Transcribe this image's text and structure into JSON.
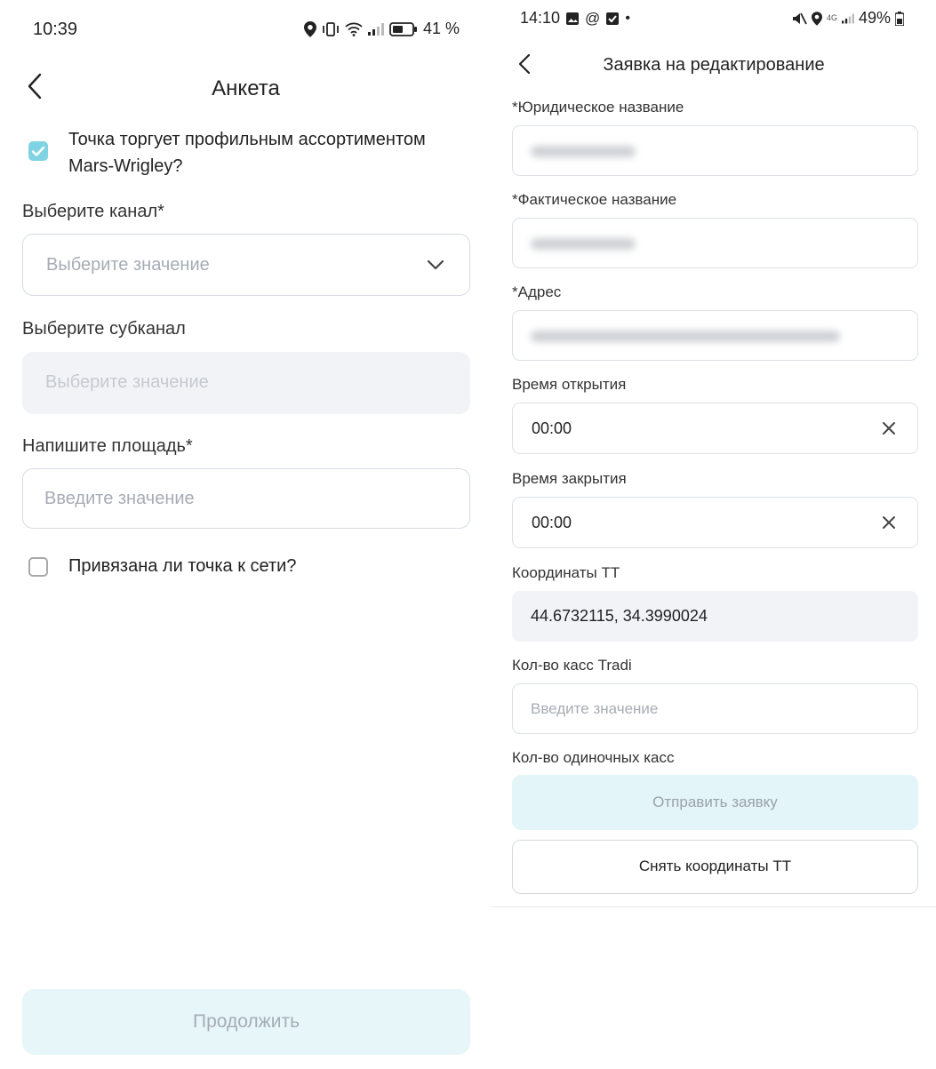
{
  "left": {
    "status": {
      "time": "10:39",
      "battery": "41 %"
    },
    "title": "Анкета",
    "question_mars": "Точка торгует профильным ассортиментом Mars-Wrigley?",
    "channel": {
      "label": "Выберите канал*",
      "placeholder": "Выберите значение"
    },
    "subchannel": {
      "label": "Выберите субканал",
      "placeholder": "Выберите значение"
    },
    "area": {
      "label": "Напишите площадь*",
      "placeholder": "Введите значение"
    },
    "question_network": "Привязана ли точка к сети?",
    "continue_label": "Продолжить"
  },
  "right": {
    "status": {
      "time": "14:10",
      "battery": "49%"
    },
    "title": "Заявка на редактирование",
    "legal_name": {
      "label": "*Юридическое название"
    },
    "actual_name": {
      "label": "*Фактическое название"
    },
    "address": {
      "label": "*Адрес"
    },
    "open_time": {
      "label": "Время открытия",
      "value": "00:00"
    },
    "close_time": {
      "label": "Время закрытия",
      "value": "00:00"
    },
    "coords": {
      "label": "Координаты ТТ",
      "value": "44.6732115, 34.3990024"
    },
    "registers_tradi": {
      "label": "Кол-во касс Tradi",
      "placeholder": "Введите значение"
    },
    "registers_single": {
      "label": "Кол-во одиночных касс"
    },
    "submit_label": "Отправить заявку",
    "take_coords_label": "Снять координаты ТТ"
  },
  "colors": {
    "accent_checkbox": "#7fd3e3",
    "disabled_button_bg": "#e6f6f9",
    "disabled_button_text": "#a5adb5"
  }
}
